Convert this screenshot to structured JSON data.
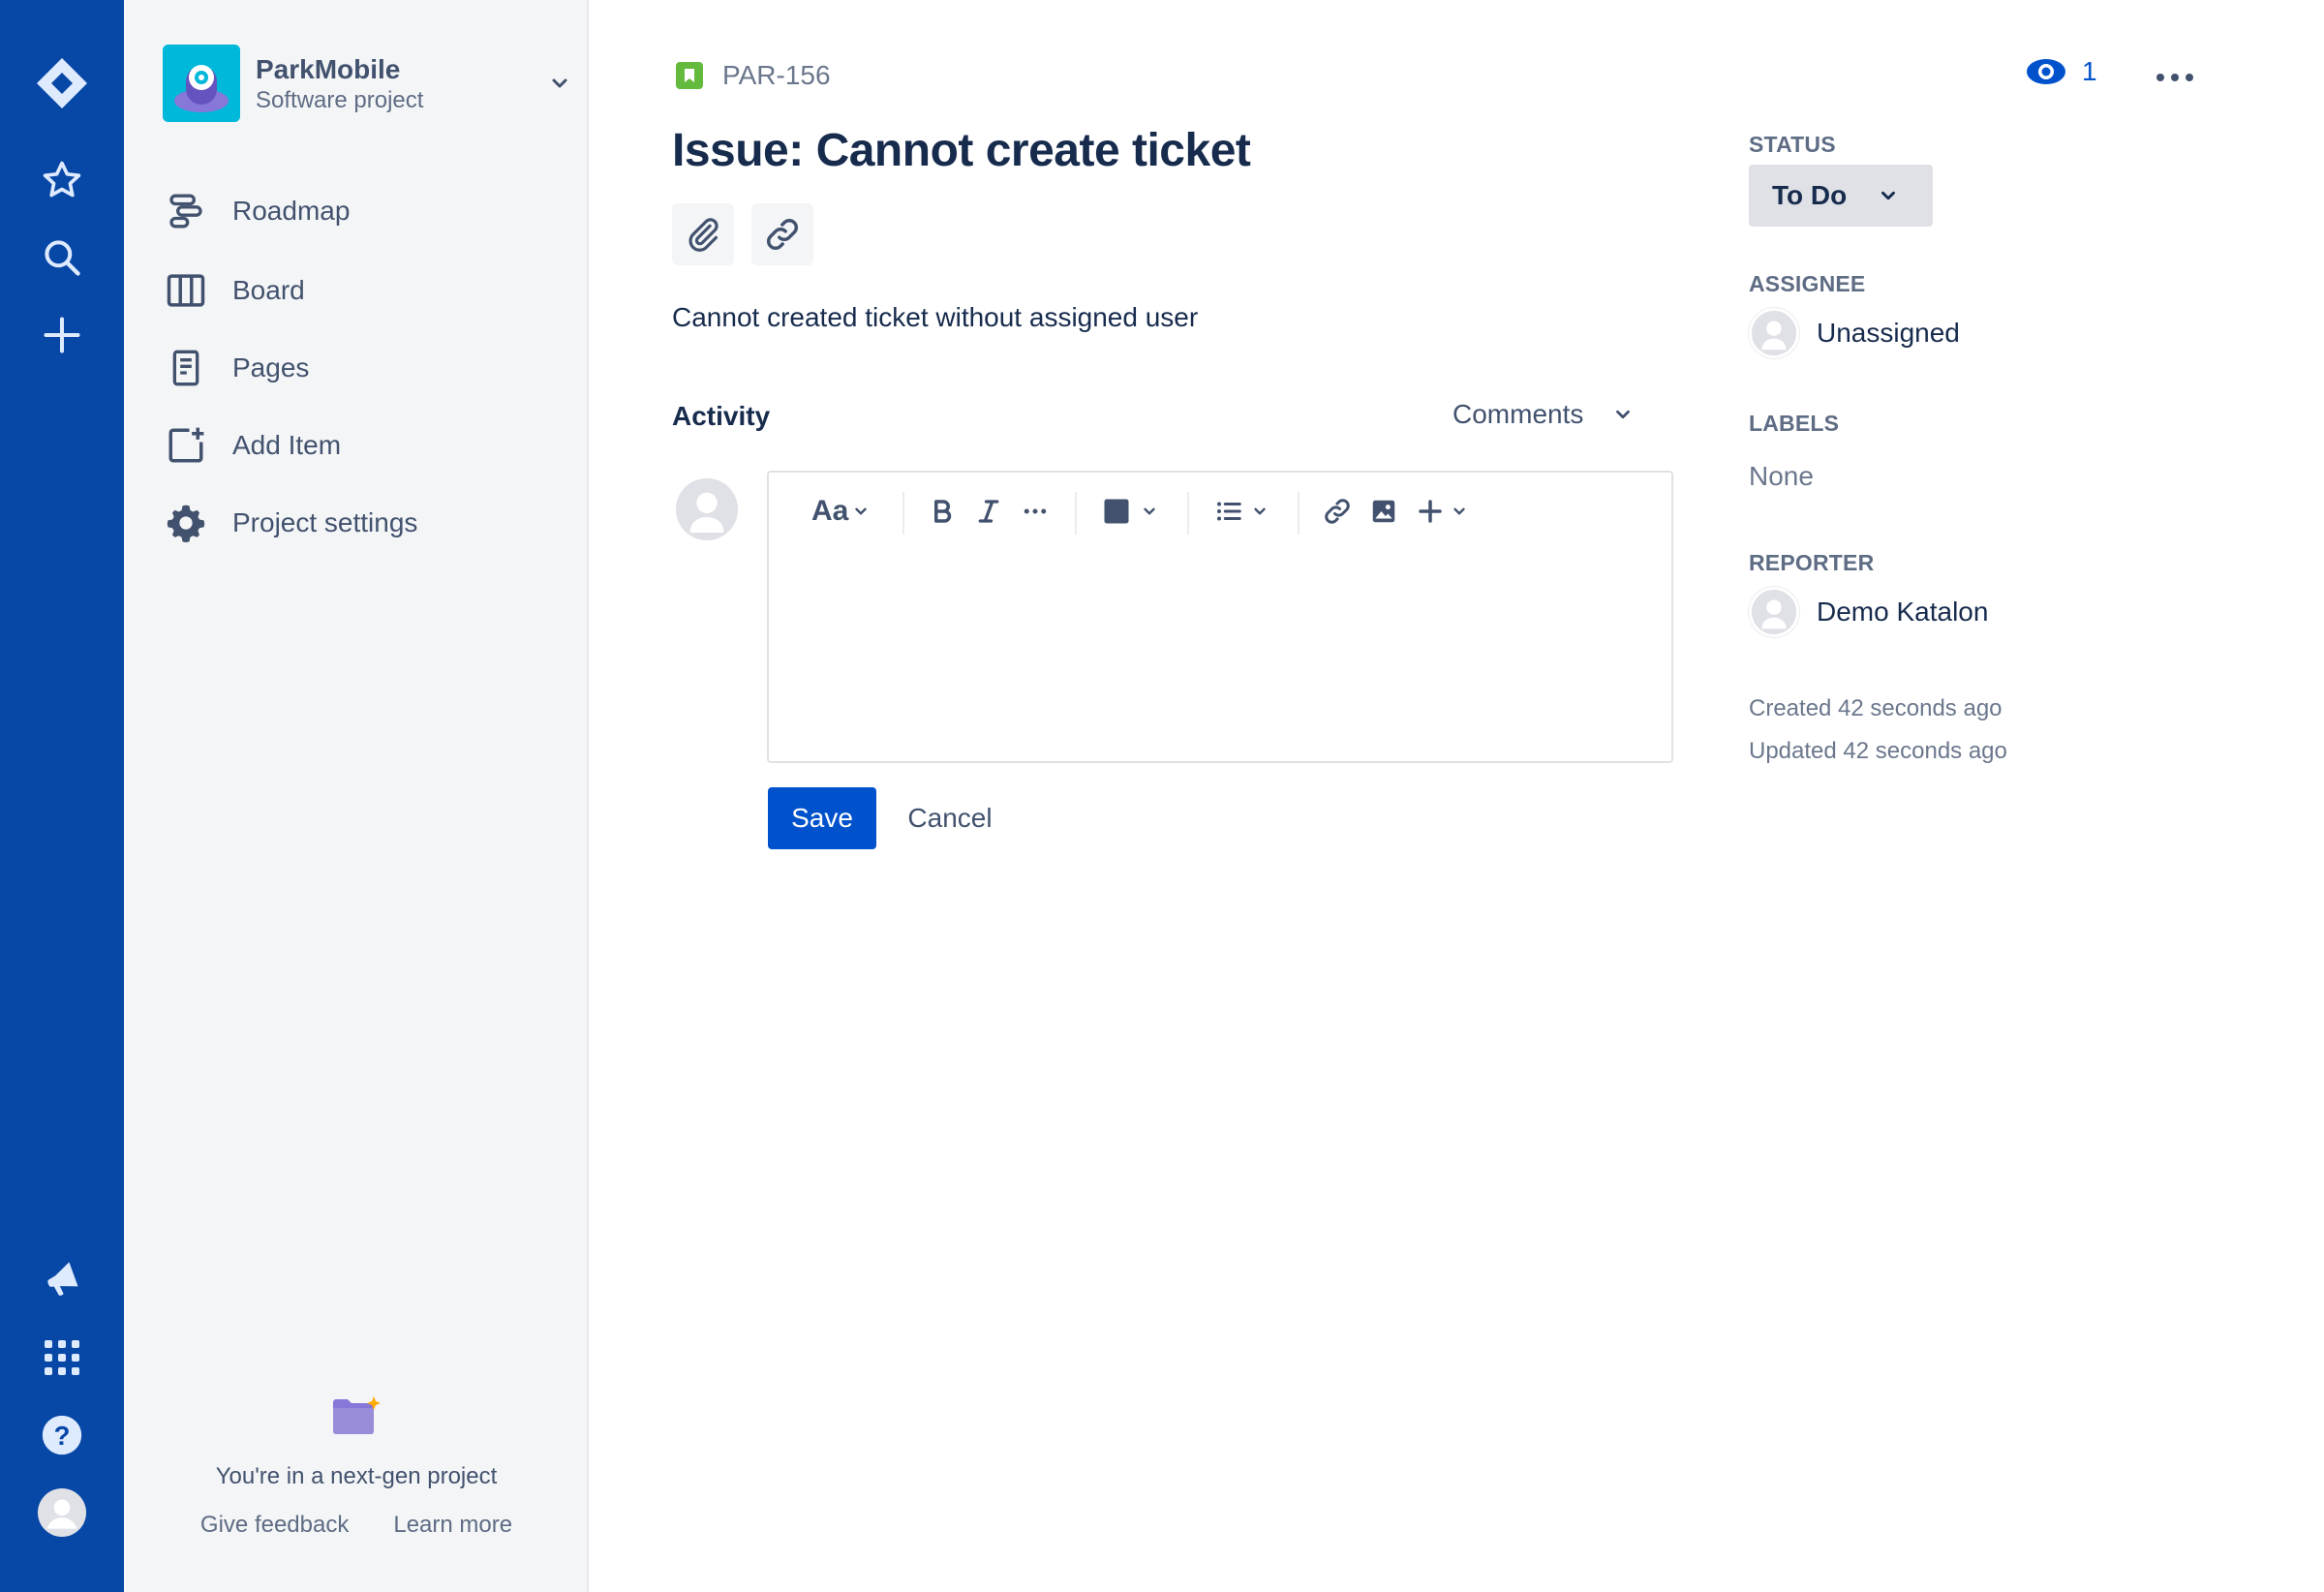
{
  "global_nav": {
    "icons": [
      "jira-logo-icon",
      "star-icon",
      "search-icon",
      "plus-icon",
      "megaphone-icon",
      "app-switcher-icon",
      "help-icon",
      "user-avatar-icon"
    ],
    "brand_color": "#0747A6"
  },
  "sidebar": {
    "project_name": "ParkMobile",
    "project_type": "Software project",
    "items": [
      {
        "label": "Roadmap",
        "icon": "roadmap-icon"
      },
      {
        "label": "Board",
        "icon": "board-icon"
      },
      {
        "label": "Pages",
        "icon": "pages-icon"
      },
      {
        "label": "Add Item",
        "icon": "add-item-icon"
      },
      {
        "label": "Project settings",
        "icon": "gear-icon"
      }
    ],
    "next_gen": {
      "text": "You're in a next-gen project",
      "give_feedback": "Give feedback",
      "learn_more": "Learn more"
    }
  },
  "issue": {
    "key": "PAR-156",
    "title": "Issue: Cannot create ticket",
    "description": "Cannot created ticket without assigned user",
    "watch_count": "1"
  },
  "activity": {
    "label": "Activity",
    "filter": "Comments",
    "editor": {
      "text_style_label": "Aa"
    },
    "save_label": "Save",
    "cancel_label": "Cancel"
  },
  "details": {
    "status_label": "STATUS",
    "status_value": "To Do",
    "assignee_label": "ASSIGNEE",
    "assignee_value": "Unassigned",
    "labels_label": "LABELS",
    "labels_value": "None",
    "reporter_label": "REPORTER",
    "reporter_value": "Demo Katalon",
    "created": "Created 42 seconds ago",
    "updated": "Updated 42 seconds ago"
  },
  "colors": {
    "primary": "#0052CC",
    "story_green": "#63BA3C",
    "text": "#172B4D",
    "subtle": "#6B778C"
  }
}
